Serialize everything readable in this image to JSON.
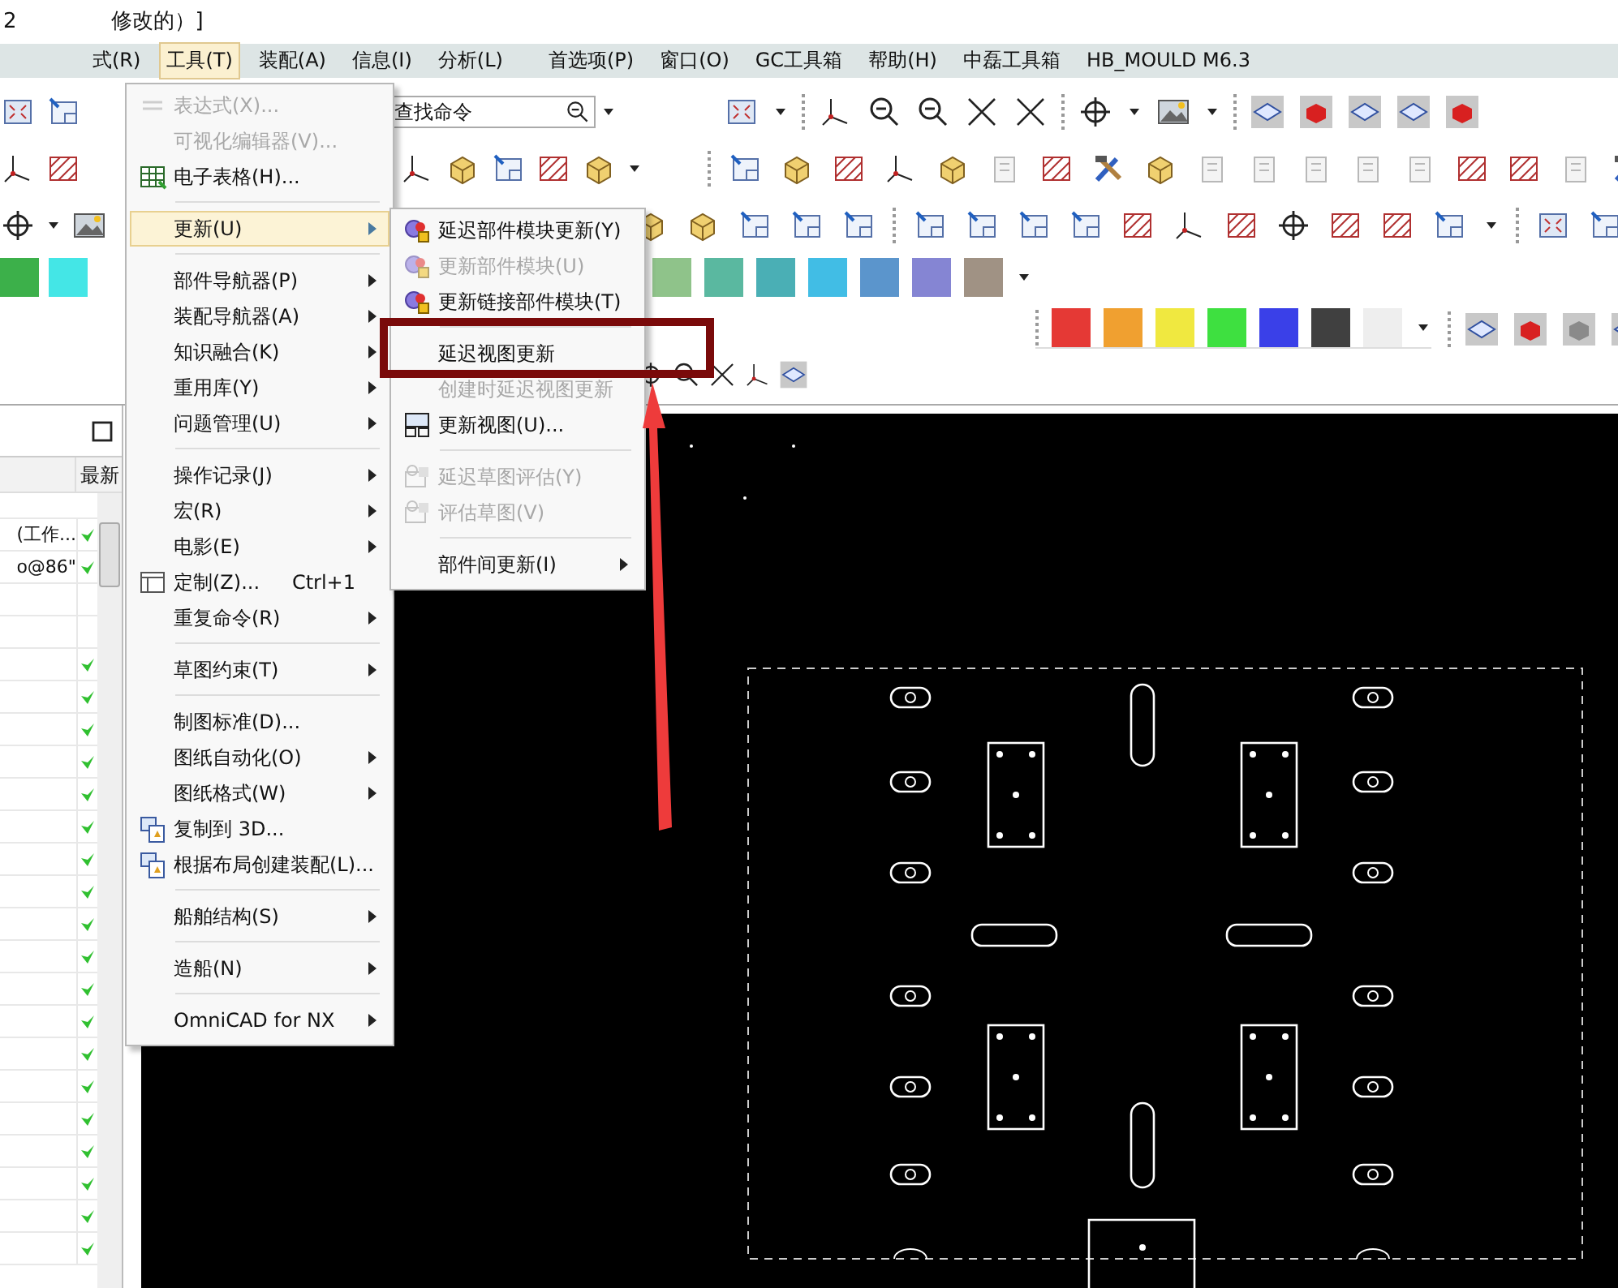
{
  "title": {
    "start": "2",
    "end": "修改的）]"
  },
  "menu_bar": [
    {
      "label": "式(R)",
      "selected": false
    },
    {
      "label": "工具(T)",
      "selected": true
    },
    {
      "label": "装配(A)",
      "selected": false
    },
    {
      "label": "信息(I)",
      "selected": false
    },
    {
      "label": "分析(L)",
      "selected": false
    },
    {
      "label": "首选项(P)",
      "selected": false
    },
    {
      "label": "窗口(O)",
      "selected": false
    },
    {
      "label": "GC工具箱",
      "selected": false
    },
    {
      "label": "帮助(H)",
      "selected": false
    },
    {
      "label": "中磊工具箱",
      "selected": false
    },
    {
      "label": "HB_MOULD M6.3",
      "selected": false
    }
  ],
  "search": {
    "placeholder": "查找命令"
  },
  "swatches_left": [
    {
      "color": "#3cb04a"
    },
    {
      "color": "#44e6e6"
    }
  ],
  "swatches_right": [
    {
      "color": "#8fc38a"
    },
    {
      "color": "#5ab8a0"
    },
    {
      "color": "#4aafb5"
    },
    {
      "color": "#41bde5"
    },
    {
      "color": "#5b95cc"
    },
    {
      "color": "#8585d3"
    },
    {
      "color": "#a09284"
    }
  ],
  "swatches_bottom": [
    {
      "color": "#e53935"
    },
    {
      "color": "#f0a030"
    },
    {
      "color": "#f0e840"
    },
    {
      "color": "#3ee040"
    },
    {
      "color": "#3a40e8"
    },
    {
      "color": "#404040"
    },
    {
      "color": "#eeeeee"
    }
  ],
  "navigator": {
    "column": "最新",
    "rows": [
      {
        "text": "(工作...",
        "checked": true
      },
      {
        "text": "o@86\"",
        "checked": true
      },
      {
        "checked": false
      },
      {
        "checked": false
      },
      {
        "checked": true
      },
      {
        "checked": true
      },
      {
        "checked": true
      },
      {
        "checked": true
      },
      {
        "checked": true
      },
      {
        "checked": true
      },
      {
        "checked": true
      },
      {
        "checked": true
      },
      {
        "checked": true
      },
      {
        "checked": true
      },
      {
        "checked": true
      },
      {
        "checked": true
      },
      {
        "checked": true
      },
      {
        "checked": true
      },
      {
        "checked": true
      },
      {
        "checked": true
      },
      {
        "checked": true
      },
      {
        "checked": true
      },
      {
        "checked": true
      }
    ]
  },
  "tools_menu": [
    {
      "kind": "item",
      "label": "表达式(X)...",
      "disabled": true,
      "selected": false,
      "submenu": false
    },
    {
      "kind": "item",
      "label": "可视化编辑器(V)...",
      "disabled": true,
      "selected": false,
      "submenu": false
    },
    {
      "kind": "item",
      "label": "电子表格(H)...",
      "disabled": false,
      "selected": false,
      "submenu": false
    },
    {
      "kind": "separator"
    },
    {
      "kind": "item",
      "label": "更新(U)",
      "disabled": false,
      "selected": true,
      "submenu": true
    },
    {
      "kind": "separator"
    },
    {
      "kind": "item",
      "label": "部件导航器(P)",
      "disabled": false,
      "selected": false,
      "submenu": true
    },
    {
      "kind": "item",
      "label": "装配导航器(A)",
      "disabled": false,
      "selected": false,
      "submenu": true
    },
    {
      "kind": "item",
      "label": "知识融合(K)",
      "disabled": false,
      "selected": false,
      "submenu": true
    },
    {
      "kind": "item",
      "label": "重用库(Y)",
      "disabled": false,
      "selected": false,
      "submenu": true
    },
    {
      "kind": "item",
      "label": "问题管理(U)",
      "disabled": false,
      "selected": false,
      "submenu": true
    },
    {
      "kind": "separator"
    },
    {
      "kind": "item",
      "label": "操作记录(J)",
      "disabled": false,
      "selected": false,
      "submenu": true
    },
    {
      "kind": "item",
      "label": "宏(R)",
      "disabled": false,
      "selected": false,
      "submenu": true
    },
    {
      "kind": "item",
      "label": "电影(E)",
      "disabled": false,
      "selected": false,
      "submenu": true
    },
    {
      "kind": "item",
      "label": "定制(Z)...",
      "disabled": false,
      "selected": false,
      "submenu": false,
      "shortcut": "Ctrl+1"
    },
    {
      "kind": "item",
      "label": "重复命令(R)",
      "disabled": false,
      "selected": false,
      "submenu": true
    },
    {
      "kind": "separator"
    },
    {
      "kind": "item",
      "label": "草图约束(T)",
      "disabled": false,
      "selected": false,
      "submenu": true
    },
    {
      "kind": "separator"
    },
    {
      "kind": "item",
      "label": "制图标准(D)...",
      "disabled": false,
      "selected": false,
      "submenu": false
    },
    {
      "kind": "item",
      "label": "图纸自动化(O)",
      "disabled": false,
      "selected": false,
      "submenu": true
    },
    {
      "kind": "item",
      "label": "图纸格式(W)",
      "disabled": false,
      "selected": false,
      "submenu": true
    },
    {
      "kind": "item",
      "label": "复制到 3D...",
      "disabled": false,
      "selected": false,
      "submenu": false
    },
    {
      "kind": "item",
      "label": "根据布局创建装配(L)...",
      "disabled": false,
      "selected": false,
      "submenu": false
    },
    {
      "kind": "separator"
    },
    {
      "kind": "item",
      "label": "船舶结构(S)",
      "disabled": false,
      "selected": false,
      "submenu": true
    },
    {
      "kind": "separator"
    },
    {
      "kind": "item",
      "label": "造船(N)",
      "disabled": false,
      "selected": false,
      "submenu": true
    },
    {
      "kind": "separator"
    },
    {
      "kind": "item",
      "label": "OmniCAD for NX",
      "disabled": false,
      "selected": false,
      "submenu": true
    }
  ],
  "update_submenu": [
    {
      "kind": "item",
      "label": "延迟部件模块更新(Y)",
      "disabled": false,
      "selected": false,
      "submenu": false
    },
    {
      "kind": "item",
      "label": "更新部件模块(U)",
      "disabled": true,
      "selected": false,
      "submenu": false
    },
    {
      "kind": "item",
      "label": "更新链接部件模块(T)",
      "disabled": false,
      "selected": false,
      "submenu": false
    },
    {
      "kind": "separator"
    },
    {
      "kind": "item",
      "label": "延迟视图更新",
      "disabled": false,
      "selected": false,
      "submenu": false
    },
    {
      "kind": "item",
      "label": "创建时延迟视图更新",
      "disabled": true,
      "selected": false,
      "submenu": false
    },
    {
      "kind": "item",
      "label": "更新视图(U)...",
      "disabled": false,
      "selected": false,
      "submenu": false
    },
    {
      "kind": "separator"
    },
    {
      "kind": "item",
      "label": "延迟草图评估(Y)",
      "disabled": true,
      "selected": false,
      "submenu": false
    },
    {
      "kind": "item",
      "label": "评估草图(V)",
      "disabled": true,
      "selected": false,
      "submenu": false
    },
    {
      "kind": "separator"
    },
    {
      "kind": "item",
      "label": "部件间更新(I)",
      "disabled": false,
      "selected": false,
      "submenu": true
    }
  ]
}
